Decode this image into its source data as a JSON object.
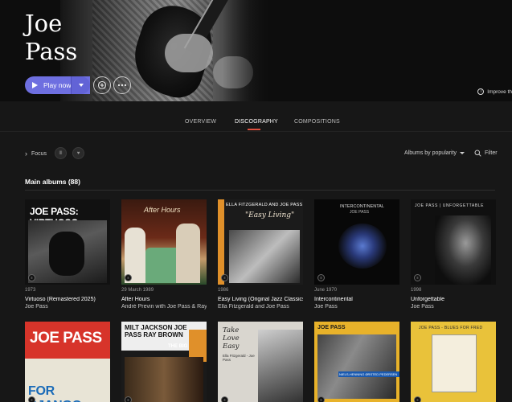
{
  "artist": {
    "name": "Joe\nPass"
  },
  "hero": {
    "play_label": "Play now",
    "improve_label": "Improve th",
    "colors": {
      "play": "#6e6fe0",
      "accent": "#e0503f"
    }
  },
  "tabs": [
    {
      "label": "OVERVIEW"
    },
    {
      "label": "DISCOGRAPHY"
    },
    {
      "label": "COMPOSITIONS"
    }
  ],
  "filters": {
    "focus_label": "Focus",
    "sort_label": "Albums by popularity",
    "filter_label": "Filter"
  },
  "section": {
    "title": "Main albums (88)"
  },
  "albums": [
    {
      "date": "1973",
      "title": "Virtuoso (Remastered 2025)",
      "artist": "Joe Pass",
      "cover_text": "JOE PASS: VIRTUOSO"
    },
    {
      "date": "29 March 1989",
      "title": "After Hours",
      "artist": "André Previn with Joe Pass & Ray B",
      "cover_text": "After Hours"
    },
    {
      "date": "1986",
      "title": "Easy Living (Original Jazz Classics R",
      "artist": "Ella Fitzgerald and Joe Pass",
      "cover_text": "ELLA FITZGERALD AND JOE PASS",
      "cover_sub": "\"Easy Living\""
    },
    {
      "date": "June 1970",
      "title": "Intercontinental",
      "artist": "Joe Pass",
      "cover_text": "INTERCONTINENTAL",
      "cover_sub": "JOE PASS"
    },
    {
      "date": "1998",
      "title": "Unforgettable",
      "artist": "Joe Pass",
      "cover_text": "JOE PASS | UNFORGETTABLE"
    },
    {
      "date": "",
      "title": "",
      "artist": "",
      "cover_text": "JOE PASS",
      "cover_sub": "FOR DJANGO"
    },
    {
      "date": "",
      "title": "",
      "artist": "",
      "cover_text": "MILT JACKSON JOE PASS RAY BROWN",
      "cover_sub": "THE BIG 3"
    },
    {
      "date": "",
      "title": "",
      "artist": "",
      "cover_text": "Take Love Easy",
      "cover_sub": "Ella Fitzgerald - Joe Pass"
    },
    {
      "date": "",
      "title": "",
      "artist": "",
      "cover_text": "JOE PASS",
      "cover_sub": "NIELS-HENNING ØRSTED PEDERSEN"
    },
    {
      "date": "",
      "title": "",
      "artist": "",
      "cover_text": "JOE PASS - BLUES FOR FRED"
    }
  ]
}
